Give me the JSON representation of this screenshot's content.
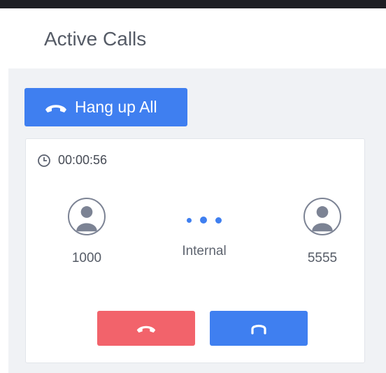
{
  "header": {
    "title": "Active Calls"
  },
  "toolbar": {
    "hangup_all_label": "Hang up All"
  },
  "call": {
    "duration": "00:00:56",
    "caller": "1000",
    "type": "Internal",
    "callee": "5555"
  },
  "icons": {
    "hangup_all": "phone-hangup-icon",
    "clock": "clock-icon",
    "avatar": "user-avatar-icon",
    "hangup": "phone-hangup-icon",
    "listen": "headphones-icon"
  },
  "colors": {
    "primary": "#3f7ff0",
    "danger": "#f2636b",
    "text": "#555b66"
  }
}
